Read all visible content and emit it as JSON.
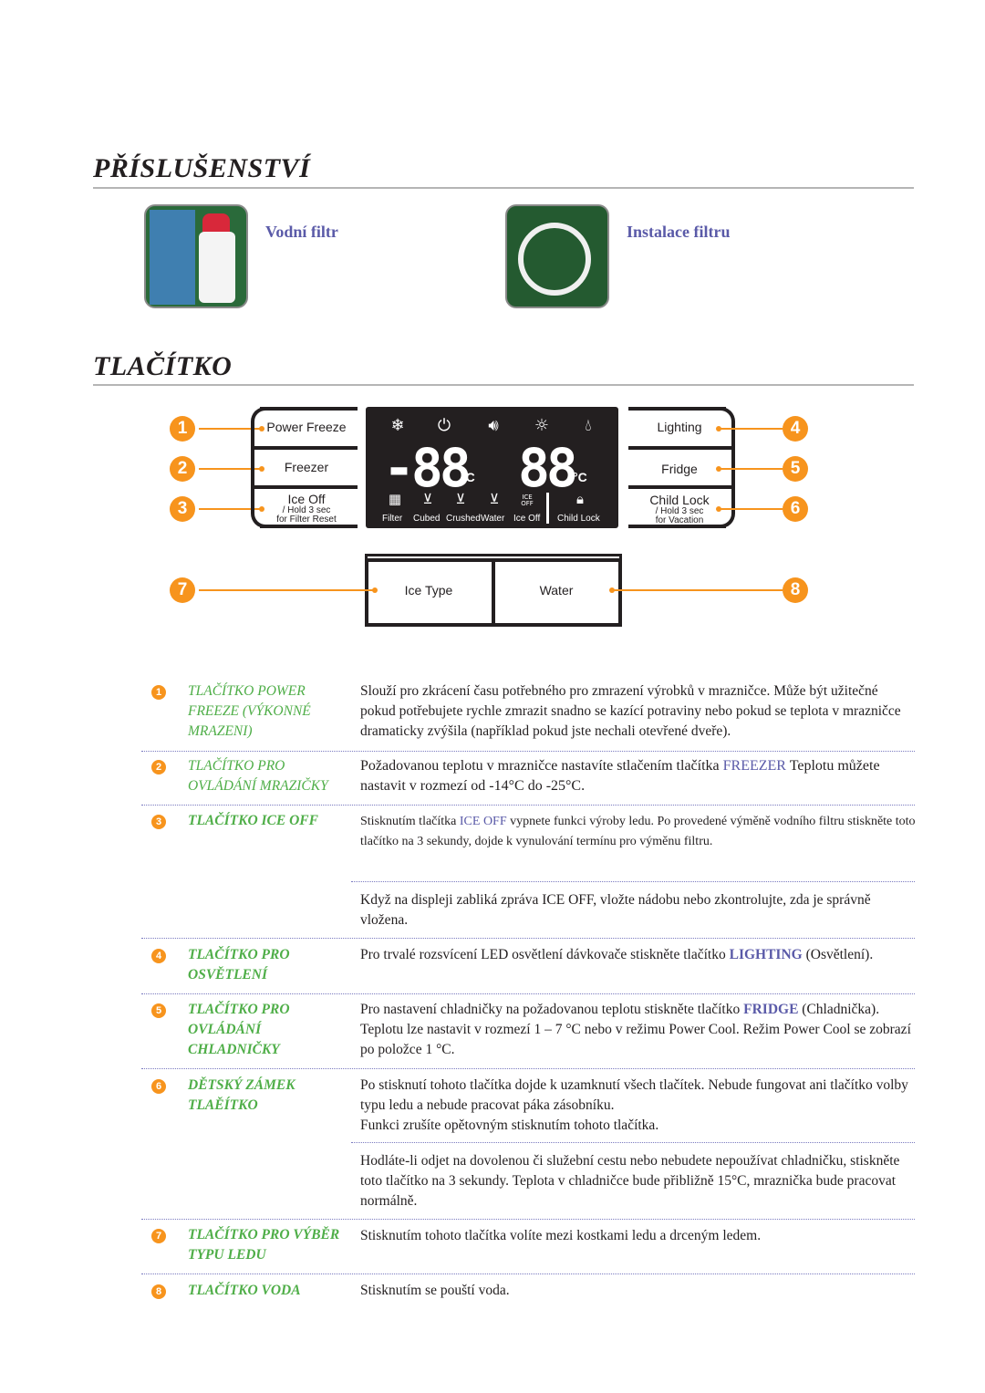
{
  "accessories": {
    "title": "PŘÍSLUŠENSTVÍ",
    "items": [
      {
        "label": "Vodní filtr",
        "image": "water-filter-photo"
      },
      {
        "label": "Instalace filtru",
        "image": "filter-installation-kit-photo"
      }
    ]
  },
  "buttons_section": {
    "title": "TLAČÍTKO"
  },
  "panel": {
    "left_buttons": [
      {
        "number": "1",
        "label": "Power Freeze",
        "sub": ""
      },
      {
        "number": "2",
        "label": "Freezer",
        "sub": ""
      },
      {
        "number": "3",
        "label": "Ice Off",
        "sub1": "/ Hold 3 sec",
        "sub2": "for Filter Reset"
      }
    ],
    "right_buttons": [
      {
        "number": "4",
        "label": "Lighting"
      },
      {
        "number": "5",
        "label": "Fridge"
      },
      {
        "number": "6",
        "label": "Child Lock",
        "sub1": "/ Hold 3 sec",
        "sub2": "for Vacation"
      }
    ],
    "display": {
      "top_icons": [
        "power-freeze-icon",
        "power-cool-icon",
        "sound-icon",
        "lighting-icon",
        "ice-drop-icon"
      ],
      "freezer_temp": "-88",
      "fridge_temp": "88",
      "unit": "°C",
      "indicators": [
        {
          "label": "Filter",
          "icon": "filter-icon"
        },
        {
          "label": "Cubed",
          "icon": "cubed-icon"
        },
        {
          "label": "Crushed",
          "icon": "crushed-icon"
        },
        {
          "label": "Water",
          "icon": "water-icon"
        },
        {
          "label": "Ice Off",
          "icon": "ice-off-icon",
          "icon_text": "ICE OFF"
        },
        {
          "label": "Child Lock",
          "icon": "lock-icon"
        }
      ]
    },
    "dispenser_buttons": [
      {
        "number": "7",
        "label": "Ice Type"
      },
      {
        "number": "8",
        "label": "Water"
      }
    ]
  },
  "descriptions": [
    {
      "number": "1",
      "title": "TLAČÍTKO POWER FREEZE (VÝKONNÉ MRAZENI)",
      "paragraphs": [
        {
          "pre": "Slouží pro zkrácení času potřebného pro zmrazení výrobků v mrazničce. Může být užitečné pokud potřebujete rychle zmrazit snadno se kazící potraviny nebo pokud se teplota v mrazničce dramaticky zvýšila (například pokud jste nechali otevřené dveře).",
          "highlight": "",
          "post": ""
        }
      ]
    },
    {
      "number": "2",
      "title": "TLAČÍTKO PRO OVLÁDÁNÍ MRAZIČKY",
      "paragraphs": [
        {
          "pre": "Požadovanou teplotu v mrazničce nastavíte stlačením tlačítka ",
          "highlight": "FREEZER",
          "post": " Teplotu můžete nastavit v rozmezí od -14°C do -25°C."
        }
      ]
    },
    {
      "number": "3",
      "title": "TLAČÍTKO ICE OFF",
      "paragraphs": [
        {
          "pre": "Stisknutím tlačítka ",
          "highlight": "ICE OFF",
          "post": " vypnete funkci výroby ledu. Po provedené výměně vodního filtru stiskněte toto tlačítko na 3 sekundy, dojde k vynulování termínu pro výměnu filtru."
        },
        {
          "pre": "Když na displeji zabliká zpráva ICE OFF, vložte nádobu nebo zkontrolujte, zda je správně vložena.",
          "highlight": "",
          "post": ""
        }
      ]
    },
    {
      "number": "4",
      "title": "TLAČÍTKO PRO OSVĚTLENÍ",
      "paragraphs": [
        {
          "pre": "Pro trvalé rozsvícení LED osvětlení dávkovače stiskněte tlačítko ",
          "highlight": "LIGHTING",
          "post": " (Osvětlení)."
        }
      ]
    },
    {
      "number": "5",
      "title": "TLAČÍTKO PRO OVLÁDÁNÍ CHLADNIČKY",
      "paragraphs": [
        {
          "pre": "Pro nastavení chladničky na požadovanou teplotu stiskněte tlačítko ",
          "highlight": "FRIDGE",
          "post": " (Chladnička). Teplotu lze nastavit v rozmezí 1 – 7 °C nebo v režimu Power Cool. Režim Power Cool se zobrazí po položce 1 °C."
        }
      ]
    },
    {
      "number": "6",
      "title": "DĚTSKÝ ZÁMEK TLAĚÍTKO",
      "paragraphs": [
        {
          "pre": "Po stisknutí tohoto tlačítka dojde k uzamknutí všech tlačítek. Nebude fungovat ani tlačítko volby typu ledu a nebude pracovat páka zásobníku.",
          "highlight": "",
          "post": ""
        },
        {
          "pre": "Funkci zrušíte opětovným stisknutím tohoto tlačítka.",
          "highlight": "",
          "post": ""
        },
        {
          "pre": "Hodláte-li odjet na dovolenou či služební cestu nebo nebudete nepoužívat chladničku, stiskněte toto tlačítko na 3 sekundy. Teplota v chladničce bude přibližně 15°C, mraznička bude pracovat normálně.",
          "highlight": "",
          "post": ""
        }
      ]
    },
    {
      "number": "7",
      "title": "TLAČÍTKO PRO VÝBĚR TYPU LEDU",
      "paragraphs": [
        {
          "pre": "Stisknutím tohoto tlačítka volíte mezi kostkami ledu a drceným ledem.",
          "highlight": "",
          "post": ""
        }
      ]
    },
    {
      "number": "8",
      "title": "TLAČÍTKO VODA",
      "paragraphs": [
        {
          "pre": "Stisknutím se pouští voda.",
          "highlight": "",
          "post": ""
        }
      ]
    }
  ],
  "colors": {
    "accent_orange": "#f7941d",
    "title_green": "#4fae48",
    "highlight_blue": "#5a5aa8",
    "display_black": "#231f20"
  }
}
